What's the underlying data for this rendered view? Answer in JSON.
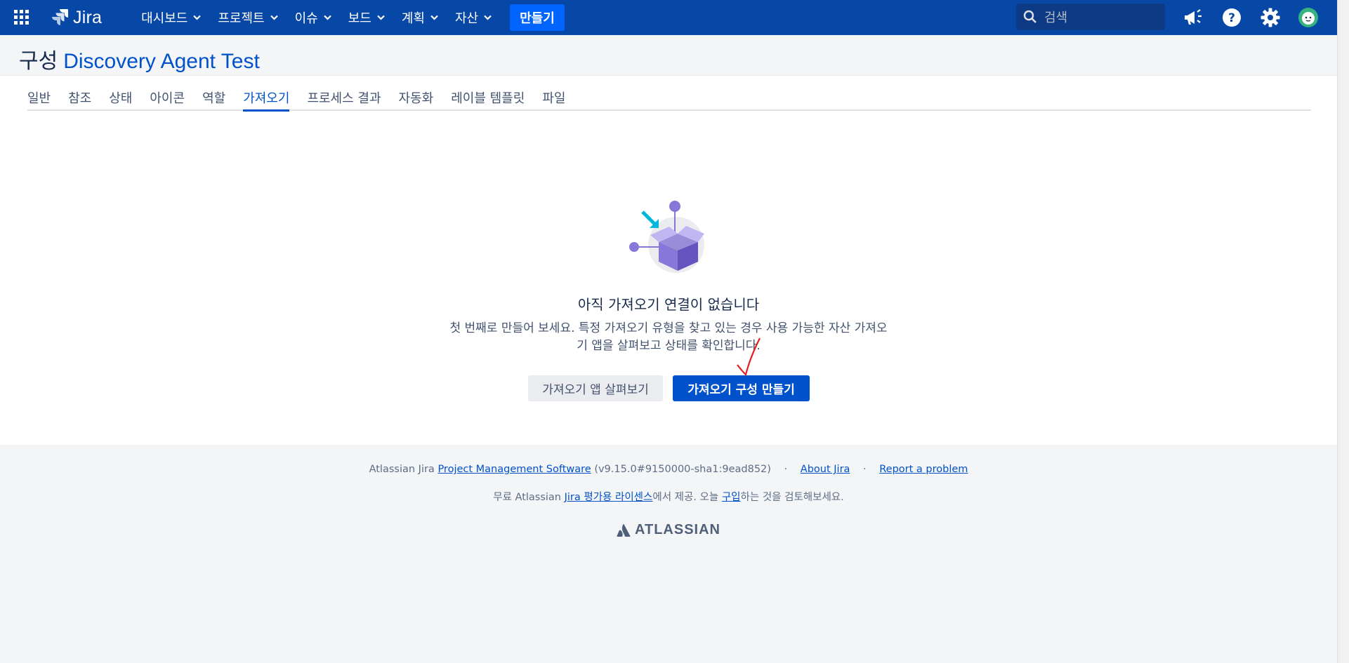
{
  "header": {
    "logo_text": "Jira",
    "nav": [
      {
        "label": "대시보드"
      },
      {
        "label": "프로젝트"
      },
      {
        "label": "이슈"
      },
      {
        "label": "보드"
      },
      {
        "label": "계획"
      },
      {
        "label": "자산"
      }
    ],
    "create_label": "만들기",
    "search_placeholder": "검색",
    "icons": [
      "app-switcher-icon",
      "notifications-icon",
      "help-icon",
      "settings-icon",
      "avatar"
    ]
  },
  "page": {
    "title_prefix": "구성",
    "project_name": "Discovery Agent Test"
  },
  "tabs": [
    {
      "label": "일반",
      "active": false
    },
    {
      "label": "참조",
      "active": false
    },
    {
      "label": "상태",
      "active": false
    },
    {
      "label": "아이콘",
      "active": false
    },
    {
      "label": "역할",
      "active": false
    },
    {
      "label": "가져오기",
      "active": true
    },
    {
      "label": "프로세스 결과",
      "active": false
    },
    {
      "label": "자동화",
      "active": false
    },
    {
      "label": "레이블 템플릿",
      "active": false
    },
    {
      "label": "파일",
      "active": false
    }
  ],
  "empty_state": {
    "title": "아직 가져오기 연결이 없습니다",
    "description": "첫 번째로 만들어 보세요. 특정 가져오기 유형을 찾고 있는 경우 사용 가능한 자산 가져오기 앱을 살펴보고 상태를 확인합니다.",
    "secondary_button": "가져오기 앱 살펴보기",
    "primary_button": "가져오기 구성 만들기"
  },
  "footer": {
    "prefix": "Atlassian Jira",
    "pm_link": "Project Management Software",
    "version": "(v9.15.0#9150000-sha1:9ead852)",
    "separator": "·",
    "about_link": "About Jira",
    "report_link": "Report a problem",
    "line2_prefix": "무료 Atlassian",
    "license_link": "Jira 평가용 라이센스",
    "line2_mid": "에서 제공. 오늘",
    "buy_link": "구입",
    "line2_suffix": "하는 것을 검토해보세요.",
    "brand": "ATLASSIAN"
  },
  "colors": {
    "header_bg": "#0747a6",
    "primary": "#0052cc",
    "create": "#0065ff",
    "page_bg": "#f4f5f7",
    "annotation": "#e02020"
  }
}
